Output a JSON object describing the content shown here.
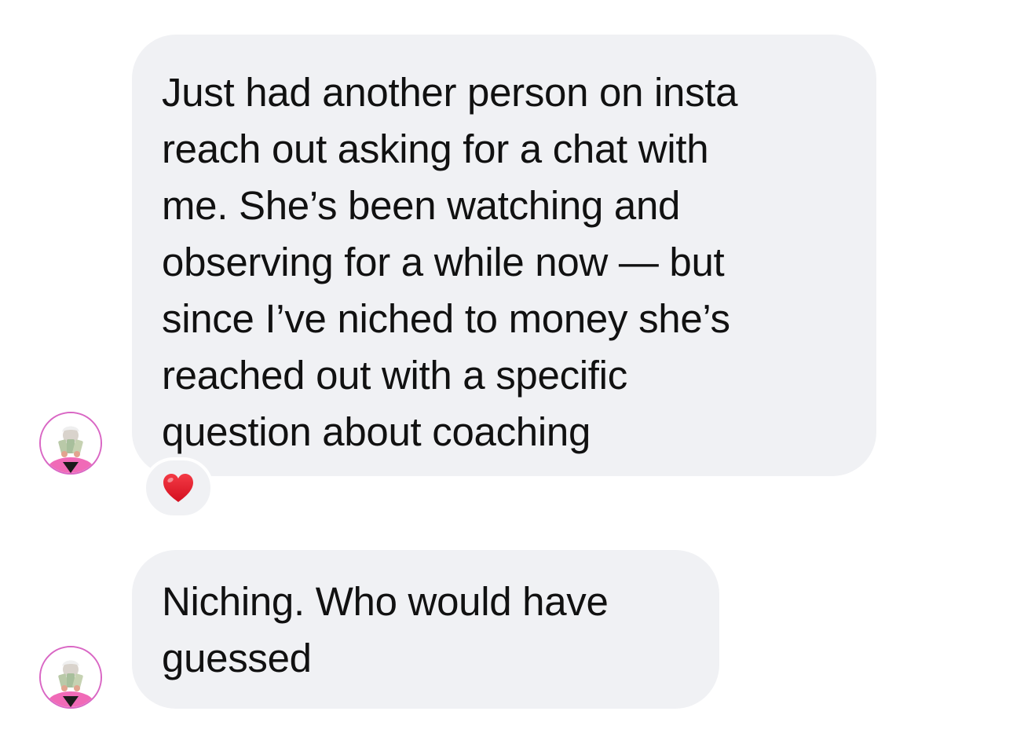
{
  "messages": [
    {
      "lines": [
        "Just had another person on insta",
        "reach out asking for a chat with",
        "me. She’s been watching and",
        "observing for a while now — but",
        "since I’ve niched to money she’s",
        "reached out with a specific",
        "question about coaching"
      ],
      "reaction": "heart-icon"
    },
    {
      "lines": [
        "Niching. Who would have",
        "guessed"
      ]
    }
  ],
  "colors": {
    "bubble": "#f0f1f4",
    "text": "#111111",
    "avatar_ring": "#d966c4",
    "heart": "#e8192c"
  }
}
